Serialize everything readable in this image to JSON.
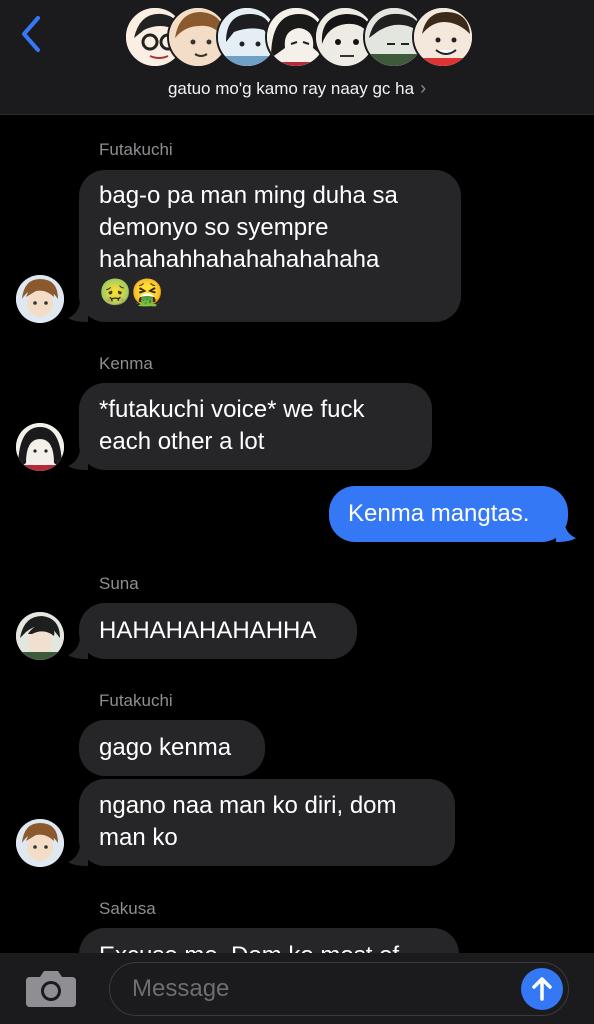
{
  "header": {
    "group_name": "gatuo mo'g kamo ray naay gc ha",
    "chevron": "›",
    "avatar_count": 7
  },
  "messages": [
    {
      "sender": "Futakuchi",
      "lines": [
        "bag-o pa man ming duha sa",
        "demonyo so syempre",
        "hahahahhahahahahahaha"
      ],
      "emoji": "🤢🤮"
    },
    {
      "sender": "Kenma",
      "lines": [
        "*futakuchi voice* we fuck",
        "each other a lot"
      ]
    },
    {
      "outgoing": true,
      "text": "Kenma mangtas."
    },
    {
      "sender": "Suna",
      "text": "HAHAHAHAHAHHA"
    },
    {
      "sender": "Futakuchi",
      "text": "gago kenma"
    },
    {
      "lines": [
        "ngano naa man ko diri, dom",
        "man ko"
      ]
    },
    {
      "sender": "Sakusa",
      "text": "Excuse me. Dom ko most of"
    }
  ],
  "composer": {
    "placeholder": "Message"
  },
  "colors": {
    "accent": "#3478f6",
    "incoming_bubble": "#262628",
    "background": "#000000"
  }
}
